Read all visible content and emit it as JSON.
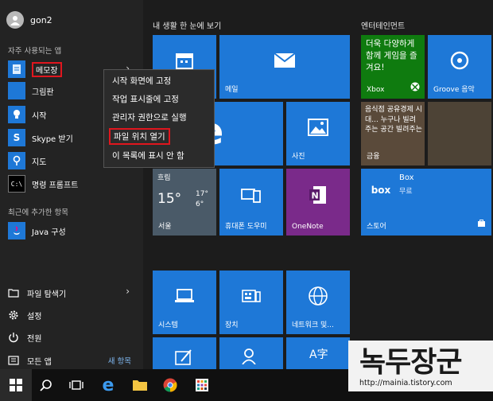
{
  "user": {
    "name": "gon2"
  },
  "most_used": {
    "label": "자주 사용되는 앱",
    "apps": [
      {
        "label": "메모장",
        "icon": "notepad-icon"
      },
      {
        "label": "그림판",
        "icon": "paint-icon"
      },
      {
        "label": "시작",
        "icon": "lightbulb-icon"
      },
      {
        "label": "Skype 받기",
        "icon": "skype-icon"
      },
      {
        "label": "지도",
        "icon": "map-icon"
      },
      {
        "label": "명령 프롬프트",
        "icon": "cmd-icon"
      }
    ]
  },
  "recently_added": {
    "label": "최근에 추가한 항목",
    "apps": [
      {
        "label": "Java 구성",
        "icon": "java-icon"
      }
    ]
  },
  "bottom": {
    "file_explorer": "파일 탐색기",
    "settings": "설정",
    "power": "전원",
    "all_apps": "모든 앱",
    "new_badge": "새 항목"
  },
  "groups": {
    "life": "내 생활 한 눈에 보기",
    "entertainment": "엔터테인먼트"
  },
  "tiles": {
    "mail": "메일",
    "photos": "사진",
    "weather_city": "서울",
    "weather_status": "흐림",
    "weather_temp": "15°",
    "weather_high": "17°",
    "weather_low": "6°",
    "phone": "휴대폰 도우미",
    "onenote": "OneNote",
    "xbox": "Xbox",
    "xbox_promo": "더욱 다양하게 함께 게임을 즐겨요!",
    "groove": "Groove 음악",
    "news": "금융",
    "news_text": "음식점 공유경제 시대... 누구나 빌려주는 공간 빌려주는",
    "box_title": "Box",
    "box_sub": "무료",
    "store": "스토어",
    "system": "시스템",
    "device": "장치",
    "network": "네트워크 및..."
  },
  "context_menu": {
    "items": [
      "시작 화면에 고정",
      "작업 표시줄에 고정",
      "관리자 권한으로 실행",
      "파일 위치 열기",
      "이 목록에 표시 안 함"
    ]
  },
  "watermark": {
    "title": "녹두장군",
    "url": "http://mainia.tistory.com"
  },
  "colors": {
    "tile_blue": "#1e78d7",
    "xbox_green": "#0f7b0f",
    "onenote_purple": "#7a2a8a",
    "highlight_red": "#e0161e"
  }
}
